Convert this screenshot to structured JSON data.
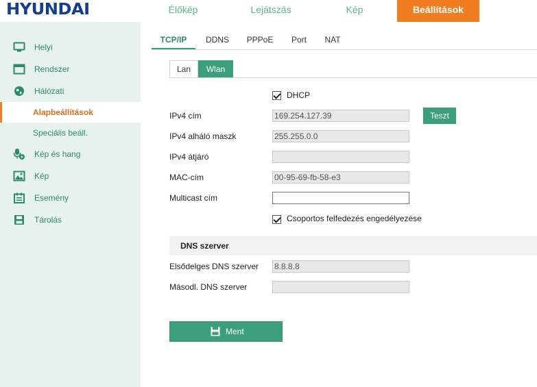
{
  "brand": {
    "logo_text": "HYUNDAI"
  },
  "topnav": {
    "tabs": [
      {
        "label": "Élőkép"
      },
      {
        "label": "Lejátszás"
      },
      {
        "label": "Kép"
      },
      {
        "label": "Beállítások",
        "active": true
      }
    ]
  },
  "sidebar": {
    "items": [
      {
        "label": "Helyi",
        "icon": "monitor-icon"
      },
      {
        "label": "Rendszer",
        "icon": "window-icon"
      },
      {
        "label": "Hálózati",
        "icon": "globe-icon"
      },
      {
        "label": "Alapbeállítások",
        "active": true
      },
      {
        "label": "Speciális beáll."
      },
      {
        "label": "Kép és hang",
        "icon": "microphone-icon"
      },
      {
        "label": "Kép",
        "icon": "image-icon"
      },
      {
        "label": "Esemény",
        "icon": "calendar-icon"
      },
      {
        "label": "Tárolás",
        "icon": "disk-icon"
      }
    ]
  },
  "subtabs": [
    {
      "label": "TCP/IP",
      "active": true
    },
    {
      "label": "DDNS"
    },
    {
      "label": "PPPoE"
    },
    {
      "label": "Port"
    },
    {
      "label": "NAT"
    }
  ],
  "iface": {
    "lan": "Lan",
    "wlan": "Wlan",
    "selected": "Wlan"
  },
  "form": {
    "dhcp_label": "DHCP",
    "dhcp_checked": true,
    "ipv4_label": "IPv4 cím",
    "ipv4_value": "169.254.127.39",
    "test_button": "Teszt",
    "mask_label": "IPv4 alháló maszk",
    "mask_value": "255.255.0.0",
    "gateway_label": "IPv4 átjáró",
    "gateway_value": "",
    "mac_label": "MAC-cím",
    "mac_value": "00-95-69-fb-58-e3",
    "multicast_label": "Multicast cím",
    "multicast_value": "",
    "group_discovery_label": "Csoportos felfedezés engedélyezése",
    "group_discovery_checked": true
  },
  "dns": {
    "header": "DNS szerver",
    "primary_label": "Elsődelges DNS szerver",
    "primary_value": "8.8.8.8",
    "secondary_label": "Másodl. DNS szerver",
    "secondary_value": ""
  },
  "actions": {
    "save_label": "Ment"
  },
  "colors": {
    "accent_green": "#3ba07a",
    "accent_orange": "#f07d1f",
    "logo_blue": "#143f8c",
    "sidebar_bg": "#e7f2ee"
  }
}
